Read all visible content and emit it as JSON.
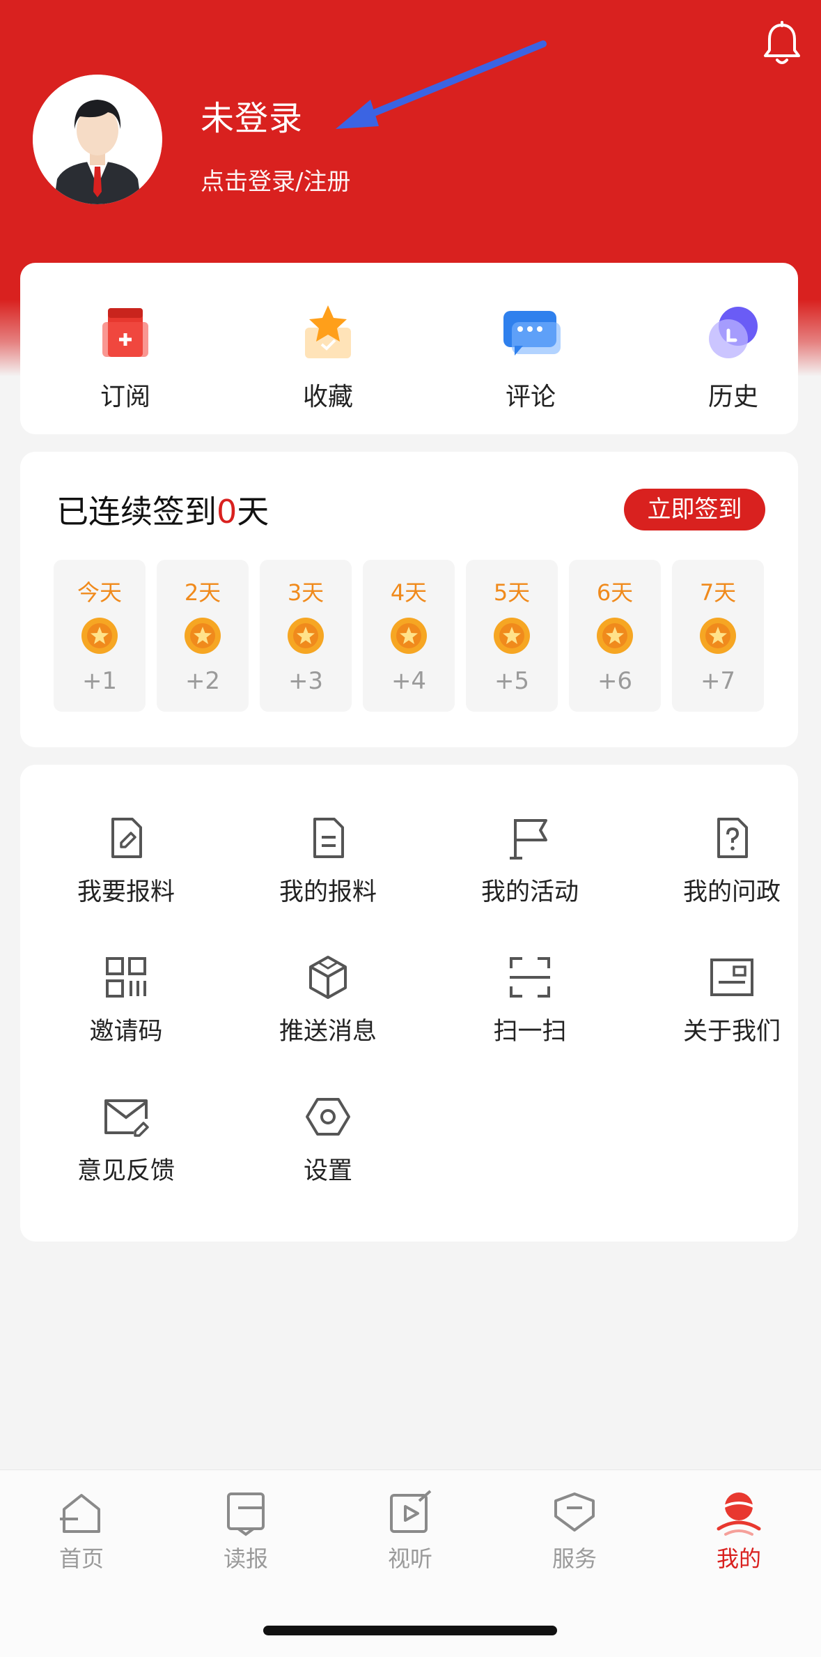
{
  "header": {
    "user_name": "未登录",
    "login_hint": "点击登录/注册",
    "notification_icon": "bell-icon",
    "background_color": "#d9211f"
  },
  "quick_actions": [
    {
      "label": "订阅",
      "icon": "subscribe-icon"
    },
    {
      "label": "收藏",
      "icon": "star-favorite-icon"
    },
    {
      "label": "评论",
      "icon": "comment-bubble-icon"
    },
    {
      "label": "历史",
      "icon": "clock-history-icon"
    }
  ],
  "checkin": {
    "title_prefix": "已连续签到",
    "streak_days": "0",
    "title_suffix": "天",
    "button_label": "立即签到",
    "days": [
      {
        "label": "今天",
        "points": "+1"
      },
      {
        "label": "2天",
        "points": "+2"
      },
      {
        "label": "3天",
        "points": "+3"
      },
      {
        "label": "4天",
        "points": "+4"
      },
      {
        "label": "5天",
        "points": "+5"
      },
      {
        "label": "6天",
        "points": "+6"
      },
      {
        "label": "7天",
        "points": "+7"
      }
    ]
  },
  "menu": [
    {
      "label": "我要报料",
      "icon": "edit-document-icon"
    },
    {
      "label": "我的报料",
      "icon": "document-icon"
    },
    {
      "label": "我的活动",
      "icon": "flag-icon"
    },
    {
      "label": "我的问政",
      "icon": "question-document-icon"
    },
    {
      "label": "邀请码",
      "icon": "qr-code-icon"
    },
    {
      "label": "推送消息",
      "icon": "cube-icon"
    },
    {
      "label": "扫一扫",
      "icon": "scan-icon"
    },
    {
      "label": "关于我们",
      "icon": "info-card-icon"
    },
    {
      "label": "意见反馈",
      "icon": "mail-edit-icon"
    },
    {
      "label": "设置",
      "icon": "settings-hexagon-icon"
    }
  ],
  "tabbar": [
    {
      "label": "首页",
      "icon": "home-icon"
    },
    {
      "label": "读报",
      "icon": "newspaper-icon"
    },
    {
      "label": "视听",
      "icon": "video-play-icon"
    },
    {
      "label": "服务",
      "icon": "service-icon"
    },
    {
      "label": "我的",
      "icon": "profile-icon",
      "active": true
    }
  ],
  "colors": {
    "accent": "#d9211f",
    "day_label": "#f08a1c",
    "muted": "#9a9a9a"
  }
}
